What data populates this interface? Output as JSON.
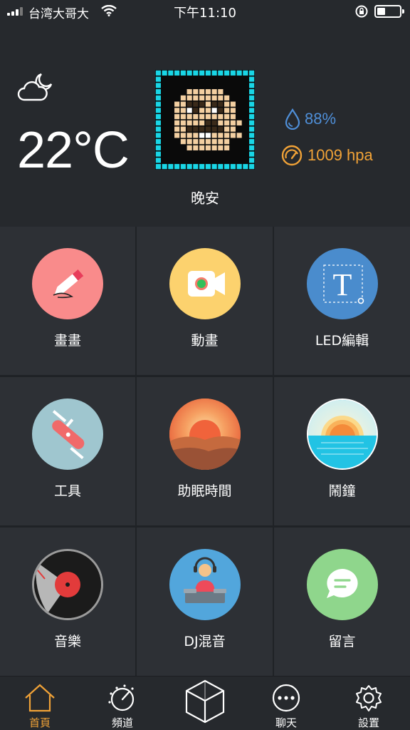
{
  "status_bar": {
    "carrier": "台湾大哥大",
    "time": "下午11:10"
  },
  "weather": {
    "temperature": "22°C",
    "humidity": "88%",
    "pressure": "1009 hpa",
    "greeting": "晚安",
    "icon": "cloud-moon-icon"
  },
  "grid": {
    "tiles": [
      {
        "label": "畫畫",
        "icon": "pencil-icon",
        "color": "#f98b8b"
      },
      {
        "label": "動畫",
        "icon": "video-camera-icon",
        "color": "#fcd26e"
      },
      {
        "label": "LED編輯",
        "icon": "text-icon",
        "color": "#4a8ccd"
      },
      {
        "label": "工具",
        "icon": "swiss-knife-icon",
        "color": "#9fc6cf"
      },
      {
        "label": "助眠時間",
        "icon": "sunset-icon",
        "color": "#f07a45"
      },
      {
        "label": "鬧鐘",
        "icon": "sunrise-icon",
        "color": "#25c6e6"
      },
      {
        "label": "音樂",
        "icon": "vinyl-record-icon",
        "color": "#1b1b1b"
      },
      {
        "label": "DJ混音",
        "icon": "dj-icon",
        "color": "#52a6dc"
      },
      {
        "label": "留言",
        "icon": "chat-bubble-icon",
        "color": "#8fd68c"
      }
    ]
  },
  "bottom_nav": {
    "items": [
      {
        "label": "首頁",
        "icon": "home-icon",
        "active": true
      },
      {
        "label": "頻道",
        "icon": "channel-dial-icon",
        "active": false
      },
      {
        "label": "",
        "icon": "cube-icon",
        "active": false
      },
      {
        "label": "聊天",
        "icon": "chat-dots-icon",
        "active": false
      },
      {
        "label": "設置",
        "icon": "gear-icon",
        "active": false
      }
    ]
  },
  "colors": {
    "accent": "#f0a237",
    "humidity": "#4f8fd8",
    "background": "#26292d",
    "tile": "#2d3035"
  }
}
